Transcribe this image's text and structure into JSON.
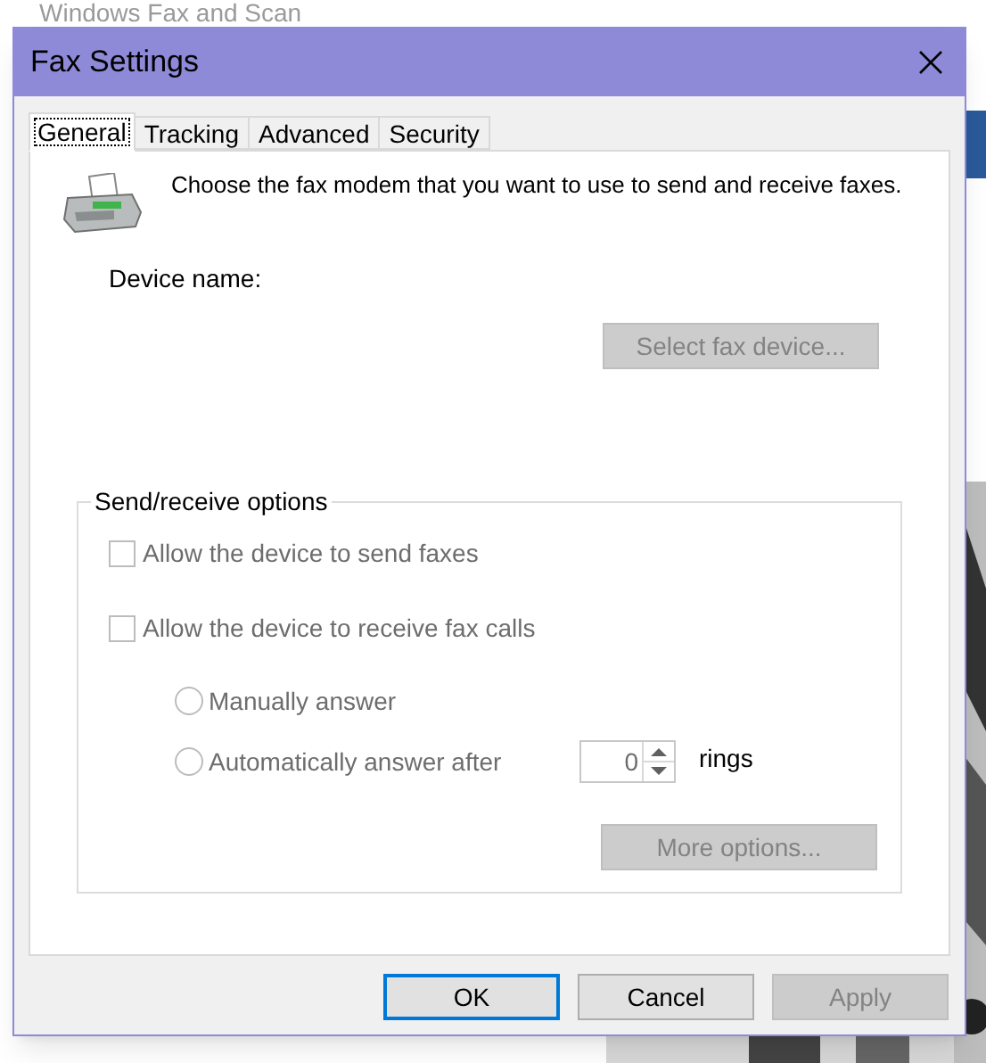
{
  "background_window": {
    "title": "Windows Fax and Scan"
  },
  "dialog": {
    "title": "Fax Settings"
  },
  "tabs": [
    {
      "label": "General",
      "selected": true
    },
    {
      "label": "Tracking",
      "selected": false
    },
    {
      "label": "Advanced",
      "selected": false
    },
    {
      "label": "Security",
      "selected": false
    }
  ],
  "description": "Choose the fax modem that you want to use to send and receive faxes.",
  "device_name_label": "Device name:",
  "select_device_button": {
    "label": "Select fax device...",
    "disabled": true
  },
  "group": {
    "title": "Send/receive options",
    "checkboxes": [
      {
        "label": "Allow the device to send faxes",
        "checked": false,
        "disabled": true
      },
      {
        "label": "Allow the device to receive fax calls",
        "checked": false,
        "disabled": true
      }
    ],
    "radios": [
      {
        "label": "Manually answer",
        "selected": false,
        "disabled": true
      },
      {
        "label": "Automatically answer after",
        "selected": false,
        "disabled": true
      }
    ],
    "rings": {
      "value": "0",
      "unit": "rings"
    },
    "more_options_button": {
      "label": "More options...",
      "disabled": true
    }
  },
  "buttons": [
    {
      "label": "OK",
      "default": true,
      "disabled": false
    },
    {
      "label": "Cancel",
      "default": false,
      "disabled": false
    },
    {
      "label": "Apply",
      "default": false,
      "disabled": true
    }
  ]
}
